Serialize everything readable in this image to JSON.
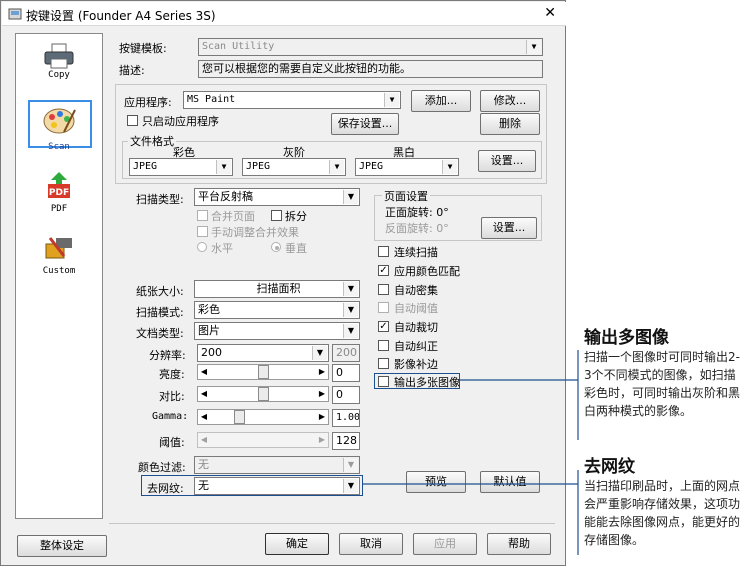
{
  "window": {
    "title": "按键设置 (Founder A4 Series 3S)",
    "close_glyph": "✕"
  },
  "sidebar": {
    "items": [
      {
        "label": "Copy",
        "icon": "printer-icon"
      },
      {
        "label": "Scan",
        "icon": "paint-palette-icon",
        "selected": true
      },
      {
        "label": "PDF",
        "icon": "pdf-icon",
        "badge": "PDF"
      },
      {
        "label": "Custom",
        "icon": "tools-icon"
      }
    ]
  },
  "template": {
    "label": "按键模板:",
    "value": "Scan Utility",
    "desc_label": "描述:",
    "description": "您可以根据您的需要自定义此按钮的功能。"
  },
  "app": {
    "label": "应用程序:",
    "value": "MS Paint",
    "add_label": "添加...",
    "modify_label": "修改...",
    "delete_label": "删除",
    "only_launch_label": "只启动应用程序",
    "save_settings_label": "保存设置..."
  },
  "file_format": {
    "group_label": "文件格式",
    "color_label": "彩色",
    "gray_label": "灰阶",
    "bw_label": "黑白",
    "color_value": "JPEG",
    "gray_value": "JPEG",
    "bw_value": "JPEG",
    "settings_label": "设置..."
  },
  "scan_type": {
    "label": "扫描类型:",
    "value": "平台反射稿",
    "merge_label": "合并页面",
    "split_label": "拆分",
    "manual_merge_label": "手动调整合并效果",
    "horizontal_label": "水平",
    "vertical_label": "垂直"
  },
  "page_settings": {
    "group_label": "页面设置",
    "front_rotation": "正面旋转: 0°",
    "back_rotation": "反面旋转: 0°",
    "settings_label": "设置..."
  },
  "options": [
    {
      "label": "连续扫描",
      "checked": false,
      "enabled": true
    },
    {
      "label": "应用颜色匹配",
      "checked": true,
      "enabled": true
    },
    {
      "label": "自动密集",
      "checked": false,
      "enabled": true
    },
    {
      "label": "自动阈值",
      "checked": false,
      "enabled": false
    },
    {
      "label": "自动裁切",
      "checked": true,
      "enabled": true
    },
    {
      "label": "自动纠正",
      "checked": false,
      "enabled": true
    },
    {
      "label": "影像补边",
      "checked": false,
      "enabled": true
    },
    {
      "label": "输出多张图像",
      "checked": false,
      "enabled": true
    }
  ],
  "scan_params": {
    "paper_size_label": "纸张大小:",
    "paper_size_value": "扫描面积",
    "scan_mode_label": "扫描模式:",
    "scan_mode_value": "彩色",
    "doc_type_label": "文档类型:",
    "doc_type_value": "图片",
    "resolution_label": "分辨率:",
    "resolution_value": "200",
    "resolution_extra": "200",
    "brightness_label": "亮度:",
    "brightness_value": "0",
    "brightness_level": 0.5,
    "contrast_label": "对比:",
    "contrast_value": "0",
    "contrast_level": 0.5,
    "gamma_label": "Gamma:",
    "gamma_value": "1.00",
    "gamma_level": 0.25,
    "threshold_label": "阈值:",
    "threshold_value": "128",
    "threshold_level": 0.5,
    "color_filter_label": "颜色过滤:",
    "color_filter_value": "无",
    "descreen_label": "去网纹:",
    "descreen_value": "无",
    "preview_label": "预览",
    "default_label": "默认值"
  },
  "footer": {
    "overall_label": "整体设定",
    "ok_label": "确定",
    "cancel_label": "取消",
    "apply_label": "应用",
    "help_label": "帮助"
  },
  "annotations": {
    "multi_title": "输出多图像",
    "multi_body": "扫描一个图像时可同时输出2-3个不同模式的图像，如扫描彩色时，可同时输出灰阶和黑白两种模式的影像。",
    "descreen_title": "去网纹",
    "descreen_body": "当扫描印刷品时，上面的网点会严重影响存储效果，这项功能能去除图像网点，能更好的存储图像。"
  },
  "colors": {
    "accent": "#3a8ee6",
    "highlight_border": "#1d4f91",
    "window_bg": "#f0f0f0"
  }
}
